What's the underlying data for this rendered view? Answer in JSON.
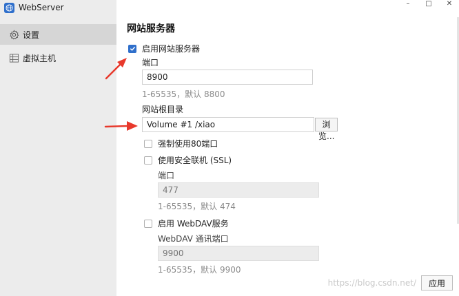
{
  "app": {
    "title": "WebServer"
  },
  "window_controls": {
    "minimize": "–",
    "maximize": "□",
    "close": "✕"
  },
  "sidebar": {
    "items": [
      {
        "label": "设置",
        "icon": "gear-icon",
        "active": true
      },
      {
        "label": "虚拟主机",
        "icon": "server-icon",
        "active": false
      }
    ]
  },
  "main": {
    "section_title": "网站服务器",
    "enable_web_server": {
      "label": "启用网站服务器",
      "checked": true
    },
    "port": {
      "label": "端口",
      "value": "8900",
      "hint": "1-65535，默认 8800"
    },
    "root_dir": {
      "label": "网站根目录",
      "value": "Volume #1 /xiao",
      "browse_label": "浏览..."
    },
    "force_port80": {
      "label": "强制使用80端口",
      "checked": false
    },
    "ssl": {
      "label": "使用安全联机 (SSL)",
      "checked": false,
      "port_label": "端口",
      "port_placeholder": "477",
      "hint": "1-65535，默认 474"
    },
    "webdav": {
      "label": "启用 WebDAV服务",
      "checked": false,
      "port_label": "WebDAV 通讯端口",
      "port_placeholder": "9900",
      "hint": "1-65535，默认 9900"
    },
    "apply_label": "应用"
  },
  "watermark": "https://blog.csdn.net/",
  "colors": {
    "accent": "#2f6fcb",
    "arrow": "#e8392c"
  }
}
